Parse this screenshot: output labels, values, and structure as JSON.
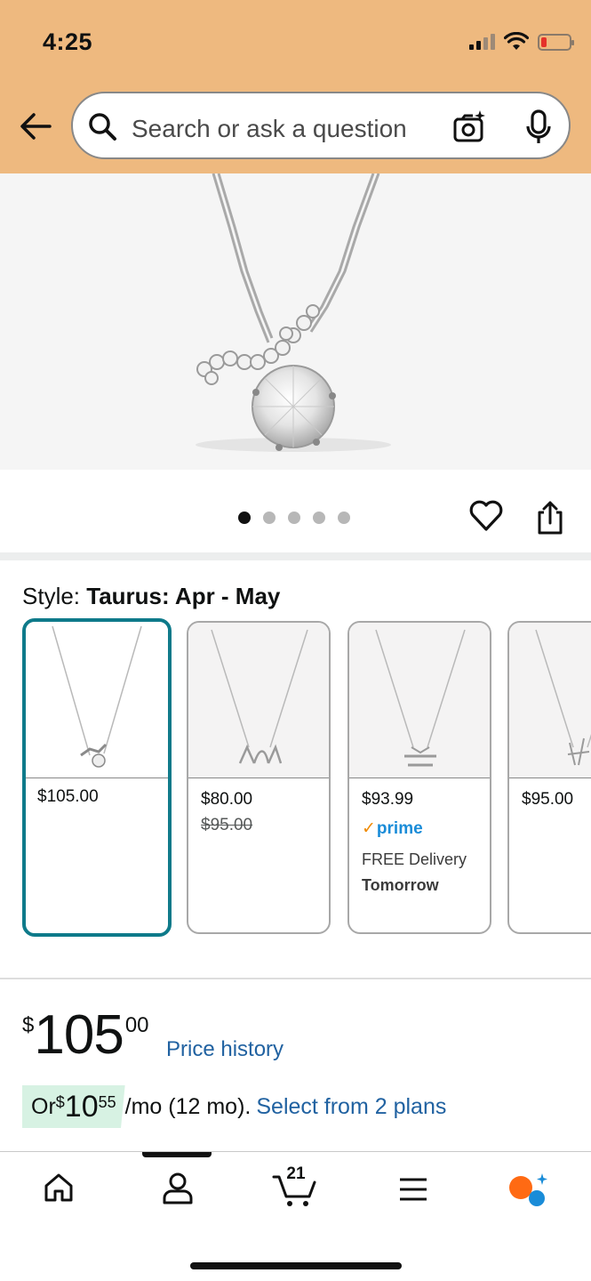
{
  "status_bar": {
    "time": "4:25"
  },
  "search": {
    "placeholder": "Search or ask a question"
  },
  "product": {
    "image_alt": "Silver zodiac pendant necklace",
    "carousel_pages": 5,
    "carousel_active_index": 0
  },
  "style": {
    "label": "Style: ",
    "value": "Taurus: Apr - May",
    "variants": [
      {
        "price": "$105.00",
        "selected": true
      },
      {
        "price": "$80.00",
        "list_price": "$95.00"
      },
      {
        "price": "$93.99",
        "prime_label": "prime",
        "delivery": "FREE Delivery",
        "delivery_day": "Tomorrow"
      },
      {
        "price": "$95.00"
      }
    ]
  },
  "pricing": {
    "currency_symbol": "$",
    "whole": "105",
    "fraction": "00",
    "price_history_label": "Price history",
    "monthly_prefix": "Or ",
    "monthly_symbol": "$",
    "monthly_whole": "10",
    "monthly_fraction": "55",
    "monthly_suffix": " /mo (12 mo).",
    "plans_link": "Select from 2 plans"
  },
  "bottom_nav": {
    "cart_count": "21",
    "items": [
      "home",
      "account",
      "cart",
      "menu",
      "rufus"
    ]
  },
  "colors": {
    "header_bg": "#eeb97f",
    "selected_border": "#0e7a8a",
    "link": "#2162a1",
    "prime_blue": "#1a8cd8",
    "installment_badge": "#d7f2e3"
  }
}
